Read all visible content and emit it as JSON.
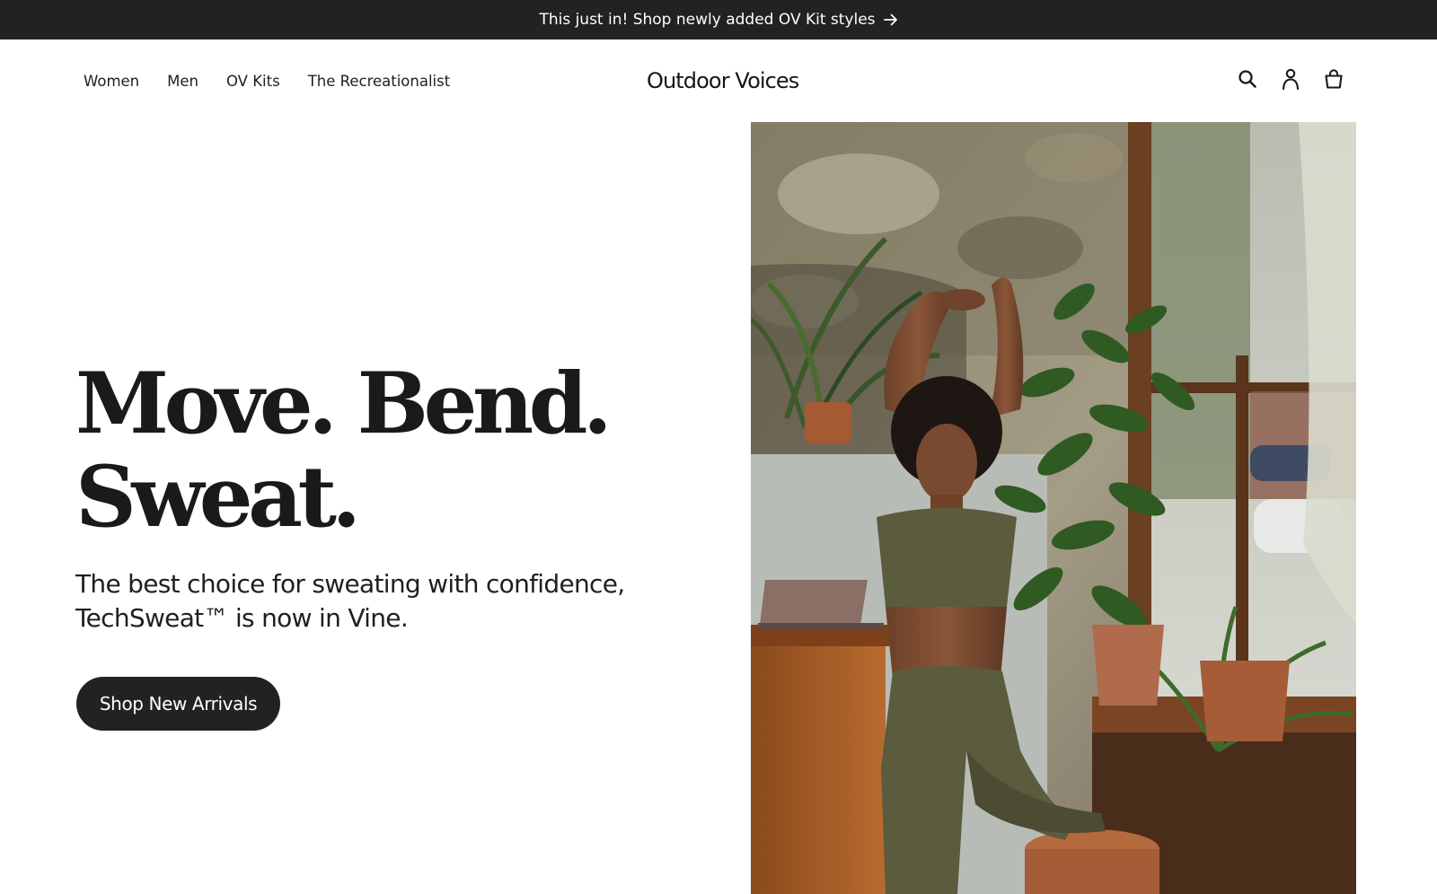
{
  "announcement": {
    "text": "This just in! Shop newly added OV Kit styles",
    "icon": "arrow-right-icon"
  },
  "nav": {
    "items": [
      {
        "label": "Women"
      },
      {
        "label": "Men"
      },
      {
        "label": "OV Kits"
      },
      {
        "label": "The Recreationalist"
      }
    ]
  },
  "brand": {
    "name": "Outdoor Voices"
  },
  "header_icons": [
    "search-icon",
    "account-icon",
    "shopping-bag-icon"
  ],
  "hero": {
    "headline_line1": "Move. Bend.",
    "headline_line2": "Sweat.",
    "subheadline_line1": "The best choice for sweating with confidence,",
    "subheadline_line2": "TechSweat™ is now in Vine.",
    "cta_label": "Shop New Arrivals",
    "image_alt": "Woman in olive-green sports bra and leggings stretching in a plant-filled room"
  },
  "colors": {
    "announcement_bg": "#222222",
    "button_bg": "#222222",
    "text": "#1f1f1f",
    "outfit_vine": "#5b5b3e"
  }
}
